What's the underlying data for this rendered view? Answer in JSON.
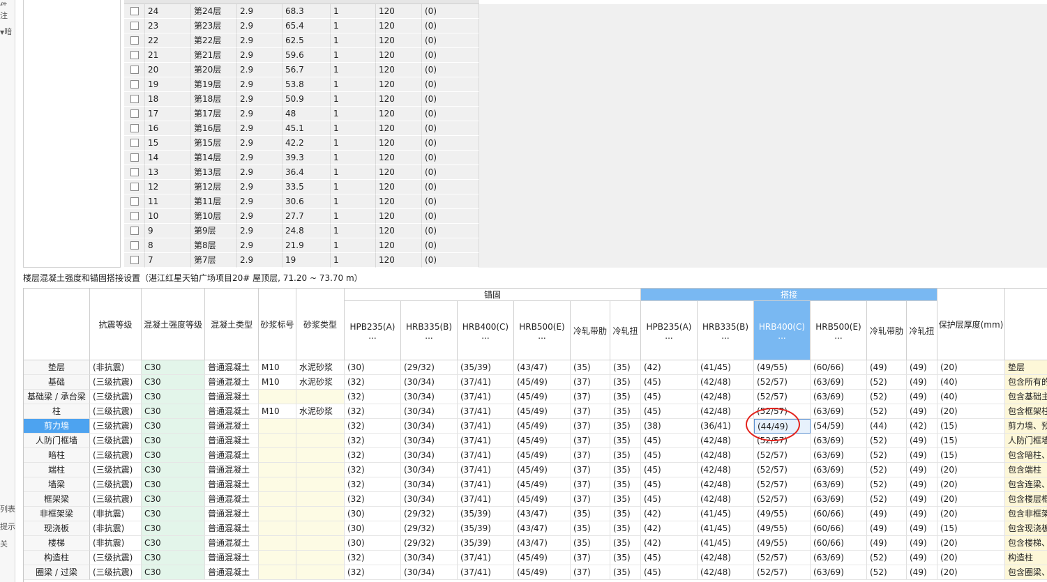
{
  "left_panel": {
    "fragments": [
      "件",
      "注",
      "暗",
      "列表",
      "提示",
      "关"
    ]
  },
  "floors": {
    "rows": [
      {
        "no": "24",
        "name": "第24层",
        "height": "2.9",
        "elev": "68.3",
        "count": "1",
        "thick": "120",
        "area": "(0)"
      },
      {
        "no": "23",
        "name": "第23层",
        "height": "2.9",
        "elev": "65.4",
        "count": "1",
        "thick": "120",
        "area": "(0)"
      },
      {
        "no": "22",
        "name": "第22层",
        "height": "2.9",
        "elev": "62.5",
        "count": "1",
        "thick": "120",
        "area": "(0)"
      },
      {
        "no": "21",
        "name": "第21层",
        "height": "2.9",
        "elev": "59.6",
        "count": "1",
        "thick": "120",
        "area": "(0)"
      },
      {
        "no": "20",
        "name": "第20层",
        "height": "2.9",
        "elev": "56.7",
        "count": "1",
        "thick": "120",
        "area": "(0)"
      },
      {
        "no": "19",
        "name": "第19层",
        "height": "2.9",
        "elev": "53.8",
        "count": "1",
        "thick": "120",
        "area": "(0)"
      },
      {
        "no": "18",
        "name": "第18层",
        "height": "2.9",
        "elev": "50.9",
        "count": "1",
        "thick": "120",
        "area": "(0)"
      },
      {
        "no": "17",
        "name": "第17层",
        "height": "2.9",
        "elev": "48",
        "count": "1",
        "thick": "120",
        "area": "(0)"
      },
      {
        "no": "16",
        "name": "第16层",
        "height": "2.9",
        "elev": "45.1",
        "count": "1",
        "thick": "120",
        "area": "(0)"
      },
      {
        "no": "15",
        "name": "第15层",
        "height": "2.9",
        "elev": "42.2",
        "count": "1",
        "thick": "120",
        "area": "(0)"
      },
      {
        "no": "14",
        "name": "第14层",
        "height": "2.9",
        "elev": "39.3",
        "count": "1",
        "thick": "120",
        "area": "(0)"
      },
      {
        "no": "13",
        "name": "第13层",
        "height": "2.9",
        "elev": "36.4",
        "count": "1",
        "thick": "120",
        "area": "(0)"
      },
      {
        "no": "12",
        "name": "第12层",
        "height": "2.9",
        "elev": "33.5",
        "count": "1",
        "thick": "120",
        "area": "(0)"
      },
      {
        "no": "11",
        "name": "第11层",
        "height": "2.9",
        "elev": "30.6",
        "count": "1",
        "thick": "120",
        "area": "(0)"
      },
      {
        "no": "10",
        "name": "第10层",
        "height": "2.9",
        "elev": "27.7",
        "count": "1",
        "thick": "120",
        "area": "(0)"
      },
      {
        "no": "9",
        "name": "第9层",
        "height": "2.9",
        "elev": "24.8",
        "count": "1",
        "thick": "120",
        "area": "(0)"
      },
      {
        "no": "8",
        "name": "第8层",
        "height": "2.9",
        "elev": "21.9",
        "count": "1",
        "thick": "120",
        "area": "(0)"
      },
      {
        "no": "7",
        "name": "第7层",
        "height": "2.9",
        "elev": "19",
        "count": "1",
        "thick": "120",
        "area": "(0)"
      }
    ]
  },
  "section": {
    "title": "楼层混凝土强度和锚固搭接设置（湛江红星天铂广场项目20#  屋顶层, 71.20 ~ 73.70 m）"
  },
  "table": {
    "group_anchor": "锚固",
    "group_lap": "搭接",
    "headers": {
      "seismic": "抗震等级",
      "concrete_grade": "混凝土强度等级",
      "concrete_type": "混凝土类型",
      "mortar_grade": "砂浆标号",
      "mortar_type": "砂浆类型",
      "hpb235": "HPB235(A)",
      "hrb335": "HRB335(B)",
      "hrb400": "HRB400(C)",
      "hrb500": "HRB500(E)",
      "cold_rolled_ribbed": "冷轧带肋",
      "cold_rolled_twisted": "冷轧扭",
      "cover": "保护层厚度(mm)",
      "ellipsis": "..."
    },
    "selected_row": "剪力墙",
    "selected_column": "lap.hrb400",
    "colors": {
      "highlight": "#79b8f2",
      "annotation": "#e3221c",
      "concrete_cell": "#e3f5ea",
      "mortar_cell": "#fdfbe4"
    },
    "rows": [
      {
        "name": "垫层",
        "seismic": "(非抗震)",
        "grade": "C30",
        "ctype": "普通混凝土",
        "mgrade": "M10",
        "mtype": "水泥砂浆",
        "anchor": [
          "(30)",
          "(29/32)",
          "(35/39)",
          "(43/47)",
          "(35)",
          "(35)"
        ],
        "lap": [
          "(42)",
          "(41/45)",
          "(49/55)",
          "(60/66)",
          "(49)",
          "(49)"
        ],
        "cover": "(20)",
        "desc": "垫层"
      },
      {
        "name": "基础",
        "seismic": "(三级抗震)",
        "grade": "C30",
        "ctype": "普通混凝土",
        "mgrade": "M10",
        "mtype": "水泥砂浆",
        "anchor": [
          "(32)",
          "(30/34)",
          "(37/41)",
          "(45/49)",
          "(37)",
          "(35)"
        ],
        "lap": [
          "(45)",
          "(42/48)",
          "(52/57)",
          "(63/69)",
          "(52)",
          "(49)"
        ],
        "cover": "(40)",
        "desc": "包含所有的"
      },
      {
        "name": "基础梁 / 承台梁",
        "seismic": "(三级抗震)",
        "grade": "C30",
        "ctype": "普通混凝土",
        "mgrade": "",
        "mtype": "",
        "anchor": [
          "(32)",
          "(30/34)",
          "(37/41)",
          "(45/49)",
          "(37)",
          "(35)"
        ],
        "lap": [
          "(45)",
          "(42/48)",
          "(52/57)",
          "(63/69)",
          "(52)",
          "(49)"
        ],
        "cover": "(40)",
        "desc": "包含基础主"
      },
      {
        "name": "柱",
        "seismic": "(三级抗震)",
        "grade": "C30",
        "ctype": "普通混凝土",
        "mgrade": "M10",
        "mtype": "水泥砂浆",
        "anchor": [
          "(32)",
          "(30/34)",
          "(37/41)",
          "(45/49)",
          "(37)",
          "(35)"
        ],
        "lap": [
          "(45)",
          "(42/48)",
          "(52/57)",
          "(63/69)",
          "(52)",
          "(49)"
        ],
        "cover": "(20)",
        "desc": "包含框架柱"
      },
      {
        "name": "剪力墙",
        "seismic": "(三级抗震)",
        "grade": "C30",
        "ctype": "普通混凝土",
        "mgrade": "",
        "mtype": "",
        "anchor": [
          "(32)",
          "(30/34)",
          "(37/41)",
          "(45/49)",
          "(37)",
          "(35)"
        ],
        "lap": [
          "(38)",
          "(36/41)",
          "(44/49)",
          "(54/59)",
          "(44)",
          "(42)"
        ],
        "cover": "(15)",
        "desc": "剪力墙、预"
      },
      {
        "name": "人防门框墙",
        "seismic": "(三级抗震)",
        "grade": "C30",
        "ctype": "普通混凝土",
        "mgrade": "",
        "mtype": "",
        "anchor": [
          "(32)",
          "(30/34)",
          "(37/41)",
          "(45/49)",
          "(37)",
          "(35)"
        ],
        "lap": [
          "(45)",
          "(42/48)",
          "(52/57)",
          "(63/69)",
          "(52)",
          "(49)"
        ],
        "cover": "(15)",
        "desc": "人防门框墙"
      },
      {
        "name": "暗柱",
        "seismic": "(三级抗震)",
        "grade": "C30",
        "ctype": "普通混凝土",
        "mgrade": "",
        "mtype": "",
        "anchor": [
          "(32)",
          "(30/34)",
          "(37/41)",
          "(45/49)",
          "(37)",
          "(35)"
        ],
        "lap": [
          "(45)",
          "(42/48)",
          "(52/57)",
          "(63/69)",
          "(52)",
          "(49)"
        ],
        "cover": "(15)",
        "desc": "包含暗柱、"
      },
      {
        "name": "端柱",
        "seismic": "(三级抗震)",
        "grade": "C30",
        "ctype": "普通混凝土",
        "mgrade": "",
        "mtype": "",
        "anchor": [
          "(32)",
          "(30/34)",
          "(37/41)",
          "(45/49)",
          "(37)",
          "(35)"
        ],
        "lap": [
          "(45)",
          "(42/48)",
          "(52/57)",
          "(63/69)",
          "(52)",
          "(49)"
        ],
        "cover": "(20)",
        "desc": "包含端柱"
      },
      {
        "name": "墙梁",
        "seismic": "(三级抗震)",
        "grade": "C30",
        "ctype": "普通混凝土",
        "mgrade": "",
        "mtype": "",
        "anchor": [
          "(32)",
          "(30/34)",
          "(37/41)",
          "(45/49)",
          "(37)",
          "(35)"
        ],
        "lap": [
          "(45)",
          "(42/48)",
          "(52/57)",
          "(63/69)",
          "(52)",
          "(49)"
        ],
        "cover": "(20)",
        "desc": "包含连梁、"
      },
      {
        "name": "框架梁",
        "seismic": "(三级抗震)",
        "grade": "C30",
        "ctype": "普通混凝土",
        "mgrade": "",
        "mtype": "",
        "anchor": [
          "(32)",
          "(30/34)",
          "(37/41)",
          "(45/49)",
          "(37)",
          "(35)"
        ],
        "lap": [
          "(45)",
          "(42/48)",
          "(52/57)",
          "(63/69)",
          "(52)",
          "(49)"
        ],
        "cover": "(20)",
        "desc": "包含楼层框"
      },
      {
        "name": "非框架梁",
        "seismic": "(非抗震)",
        "grade": "C30",
        "ctype": "普通混凝土",
        "mgrade": "",
        "mtype": "",
        "anchor": [
          "(30)",
          "(29/32)",
          "(35/39)",
          "(43/47)",
          "(35)",
          "(35)"
        ],
        "lap": [
          "(42)",
          "(41/45)",
          "(49/55)",
          "(60/66)",
          "(49)",
          "(49)"
        ],
        "cover": "(20)",
        "desc": "包含非框架"
      },
      {
        "name": "现浇板",
        "seismic": "(非抗震)",
        "grade": "C30",
        "ctype": "普通混凝土",
        "mgrade": "",
        "mtype": "",
        "anchor": [
          "(30)",
          "(29/32)",
          "(35/39)",
          "(43/47)",
          "(35)",
          "(35)"
        ],
        "lap": [
          "(42)",
          "(41/45)",
          "(49/55)",
          "(60/66)",
          "(49)",
          "(49)"
        ],
        "cover": "(15)",
        "desc": "包含现浇板"
      },
      {
        "name": "楼梯",
        "seismic": "(非抗震)",
        "grade": "C30",
        "ctype": "普通混凝土",
        "mgrade": "",
        "mtype": "",
        "anchor": [
          "(30)",
          "(29/32)",
          "(35/39)",
          "(43/47)",
          "(35)",
          "(35)"
        ],
        "lap": [
          "(42)",
          "(41/45)",
          "(49/55)",
          "(60/66)",
          "(49)",
          "(49)"
        ],
        "cover": "(20)",
        "desc": "包含楼梯、"
      },
      {
        "name": "构造柱",
        "seismic": "(三级抗震)",
        "grade": "C30",
        "ctype": "普通混凝土",
        "mgrade": "",
        "mtype": "",
        "anchor": [
          "(32)",
          "(30/34)",
          "(37/41)",
          "(45/49)",
          "(37)",
          "(35)"
        ],
        "lap": [
          "(45)",
          "(42/48)",
          "(52/57)",
          "(63/69)",
          "(52)",
          "(49)"
        ],
        "cover": "(20)",
        "desc": "构造柱"
      },
      {
        "name": "圈梁 / 过梁",
        "seismic": "(三级抗震)",
        "grade": "C30",
        "ctype": "普通混凝土",
        "mgrade": "",
        "mtype": "",
        "anchor": [
          "(32)",
          "(30/34)",
          "(37/41)",
          "(45/49)",
          "(37)",
          "(35)"
        ],
        "lap": [
          "(45)",
          "(42/48)",
          "(52/57)",
          "(63/69)",
          "(52)",
          "(49)"
        ],
        "cover": "(20)",
        "desc": "包含圈梁、"
      }
    ]
  }
}
